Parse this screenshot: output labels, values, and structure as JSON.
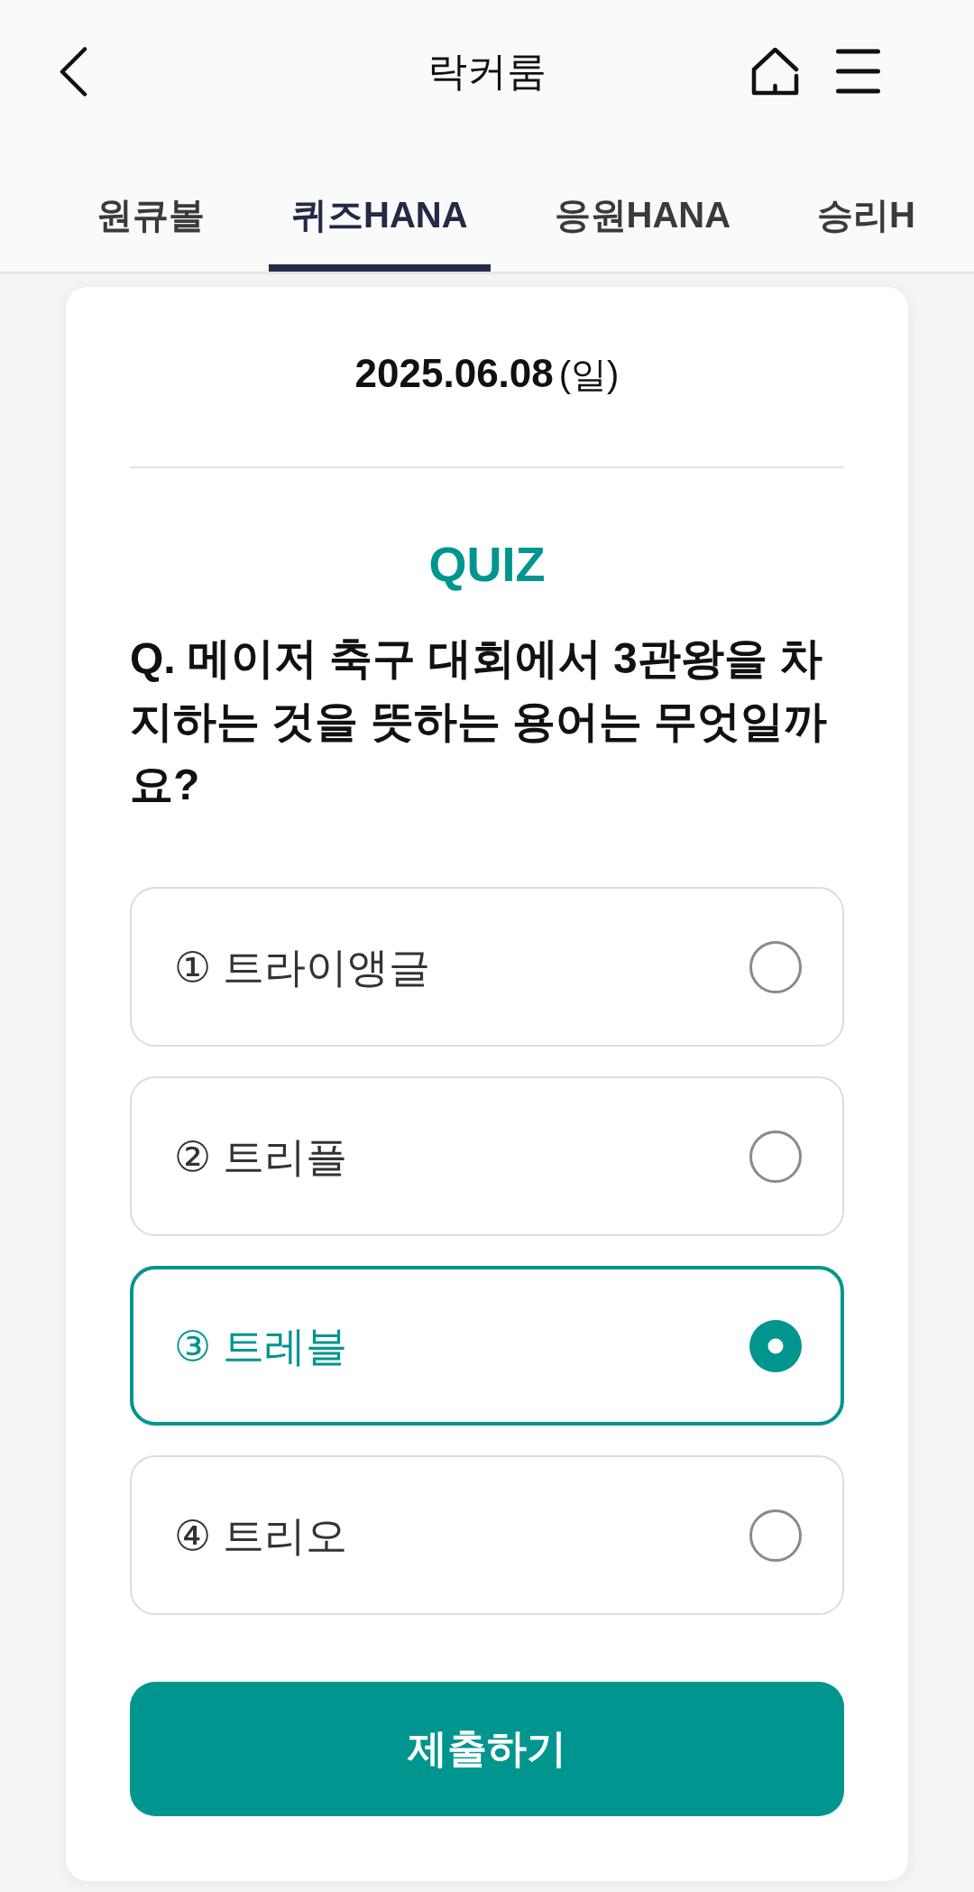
{
  "header": {
    "title": "락커룸"
  },
  "tabs": [
    {
      "label": "원큐볼",
      "selected": false
    },
    {
      "label": "퀴즈HANA",
      "selected": true
    },
    {
      "label": "응원HANA",
      "selected": false
    },
    {
      "label": "승리H",
      "selected": false
    }
  ],
  "quiz_card": {
    "date": "2025.06.08",
    "weekday": "(일)",
    "heading": "QUIZ",
    "question": "Q. 메이저 축구 대회에서 3관왕을 차지하는 것을 뜻하는 용어는 무엇일까요?",
    "options": [
      {
        "label": "① 트라이앵글",
        "selected": false
      },
      {
        "label": "② 트리플",
        "selected": false
      },
      {
        "label": "③ 트레블",
        "selected": true
      },
      {
        "label": "④ 트리오",
        "selected": false
      }
    ],
    "submit_button": "제출하기"
  }
}
